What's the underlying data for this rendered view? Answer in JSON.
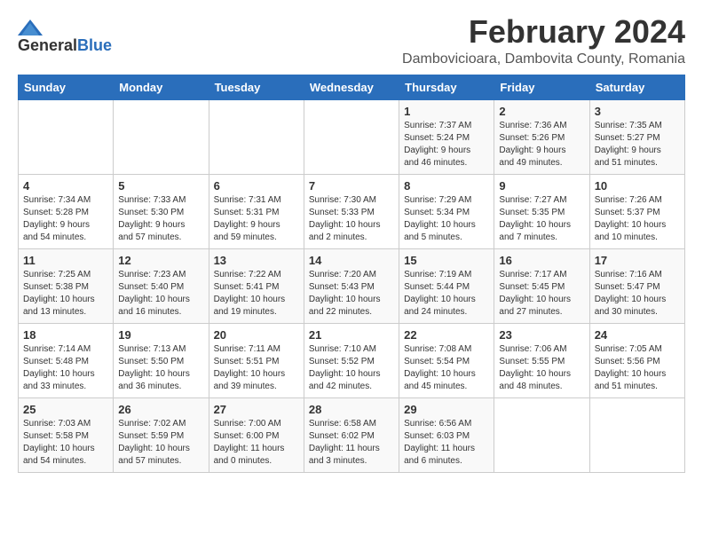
{
  "logo": {
    "general": "General",
    "blue": "Blue"
  },
  "title": "February 2024",
  "subtitle": "Dambovicioara, Dambovita County, Romania",
  "weekdays": [
    "Sunday",
    "Monday",
    "Tuesday",
    "Wednesday",
    "Thursday",
    "Friday",
    "Saturday"
  ],
  "weeks": [
    [
      {
        "day": "",
        "content": ""
      },
      {
        "day": "",
        "content": ""
      },
      {
        "day": "",
        "content": ""
      },
      {
        "day": "",
        "content": ""
      },
      {
        "day": "1",
        "content": "Sunrise: 7:37 AM\nSunset: 5:24 PM\nDaylight: 9 hours\nand 46 minutes."
      },
      {
        "day": "2",
        "content": "Sunrise: 7:36 AM\nSunset: 5:26 PM\nDaylight: 9 hours\nand 49 minutes."
      },
      {
        "day": "3",
        "content": "Sunrise: 7:35 AM\nSunset: 5:27 PM\nDaylight: 9 hours\nand 51 minutes."
      }
    ],
    [
      {
        "day": "4",
        "content": "Sunrise: 7:34 AM\nSunset: 5:28 PM\nDaylight: 9 hours\nand 54 minutes."
      },
      {
        "day": "5",
        "content": "Sunrise: 7:33 AM\nSunset: 5:30 PM\nDaylight: 9 hours\nand 57 minutes."
      },
      {
        "day": "6",
        "content": "Sunrise: 7:31 AM\nSunset: 5:31 PM\nDaylight: 9 hours\nand 59 minutes."
      },
      {
        "day": "7",
        "content": "Sunrise: 7:30 AM\nSunset: 5:33 PM\nDaylight: 10 hours\nand 2 minutes."
      },
      {
        "day": "8",
        "content": "Sunrise: 7:29 AM\nSunset: 5:34 PM\nDaylight: 10 hours\nand 5 minutes."
      },
      {
        "day": "9",
        "content": "Sunrise: 7:27 AM\nSunset: 5:35 PM\nDaylight: 10 hours\nand 7 minutes."
      },
      {
        "day": "10",
        "content": "Sunrise: 7:26 AM\nSunset: 5:37 PM\nDaylight: 10 hours\nand 10 minutes."
      }
    ],
    [
      {
        "day": "11",
        "content": "Sunrise: 7:25 AM\nSunset: 5:38 PM\nDaylight: 10 hours\nand 13 minutes."
      },
      {
        "day": "12",
        "content": "Sunrise: 7:23 AM\nSunset: 5:40 PM\nDaylight: 10 hours\nand 16 minutes."
      },
      {
        "day": "13",
        "content": "Sunrise: 7:22 AM\nSunset: 5:41 PM\nDaylight: 10 hours\nand 19 minutes."
      },
      {
        "day": "14",
        "content": "Sunrise: 7:20 AM\nSunset: 5:43 PM\nDaylight: 10 hours\nand 22 minutes."
      },
      {
        "day": "15",
        "content": "Sunrise: 7:19 AM\nSunset: 5:44 PM\nDaylight: 10 hours\nand 24 minutes."
      },
      {
        "day": "16",
        "content": "Sunrise: 7:17 AM\nSunset: 5:45 PM\nDaylight: 10 hours\nand 27 minutes."
      },
      {
        "day": "17",
        "content": "Sunrise: 7:16 AM\nSunset: 5:47 PM\nDaylight: 10 hours\nand 30 minutes."
      }
    ],
    [
      {
        "day": "18",
        "content": "Sunrise: 7:14 AM\nSunset: 5:48 PM\nDaylight: 10 hours\nand 33 minutes."
      },
      {
        "day": "19",
        "content": "Sunrise: 7:13 AM\nSunset: 5:50 PM\nDaylight: 10 hours\nand 36 minutes."
      },
      {
        "day": "20",
        "content": "Sunrise: 7:11 AM\nSunset: 5:51 PM\nDaylight: 10 hours\nand 39 minutes."
      },
      {
        "day": "21",
        "content": "Sunrise: 7:10 AM\nSunset: 5:52 PM\nDaylight: 10 hours\nand 42 minutes."
      },
      {
        "day": "22",
        "content": "Sunrise: 7:08 AM\nSunset: 5:54 PM\nDaylight: 10 hours\nand 45 minutes."
      },
      {
        "day": "23",
        "content": "Sunrise: 7:06 AM\nSunset: 5:55 PM\nDaylight: 10 hours\nand 48 minutes."
      },
      {
        "day": "24",
        "content": "Sunrise: 7:05 AM\nSunset: 5:56 PM\nDaylight: 10 hours\nand 51 minutes."
      }
    ],
    [
      {
        "day": "25",
        "content": "Sunrise: 7:03 AM\nSunset: 5:58 PM\nDaylight: 10 hours\nand 54 minutes."
      },
      {
        "day": "26",
        "content": "Sunrise: 7:02 AM\nSunset: 5:59 PM\nDaylight: 10 hours\nand 57 minutes."
      },
      {
        "day": "27",
        "content": "Sunrise: 7:00 AM\nSunset: 6:00 PM\nDaylight: 11 hours\nand 0 minutes."
      },
      {
        "day": "28",
        "content": "Sunrise: 6:58 AM\nSunset: 6:02 PM\nDaylight: 11 hours\nand 3 minutes."
      },
      {
        "day": "29",
        "content": "Sunrise: 6:56 AM\nSunset: 6:03 PM\nDaylight: 11 hours\nand 6 minutes."
      },
      {
        "day": "",
        "content": ""
      },
      {
        "day": "",
        "content": ""
      }
    ]
  ]
}
